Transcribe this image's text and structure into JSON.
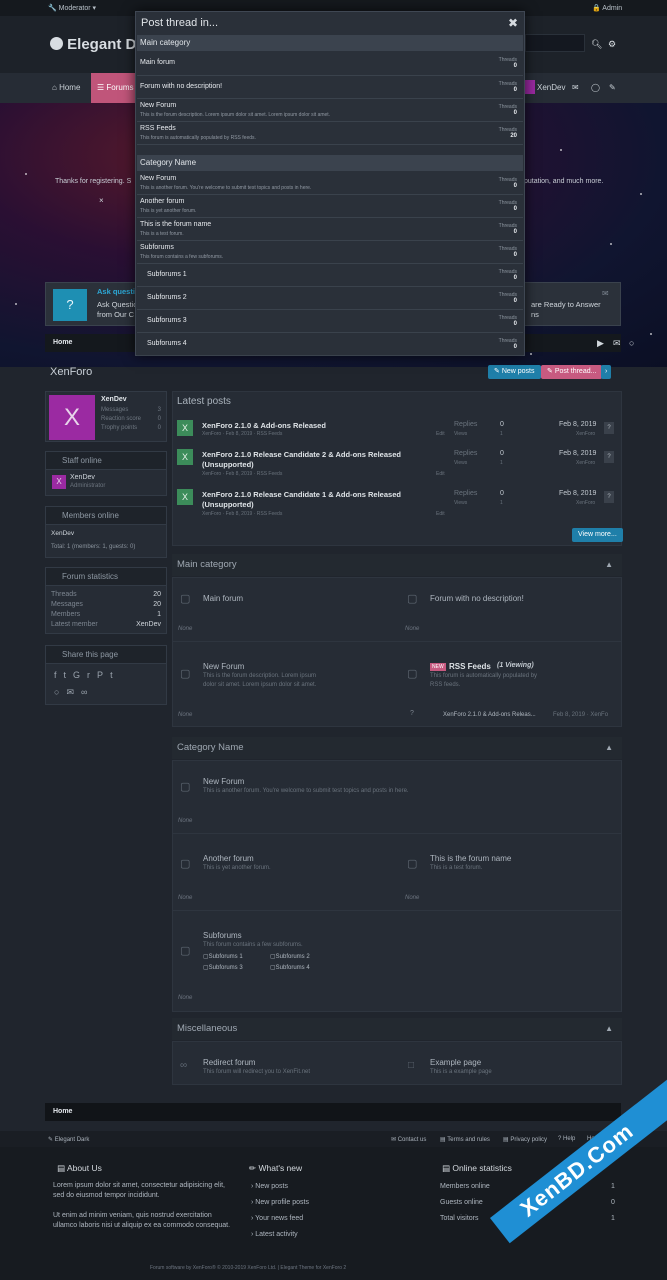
{
  "topbar": {
    "moderator": "Moderator",
    "admin": "Admin"
  },
  "header": {
    "logo": "Elegant D"
  },
  "nav": {
    "home": "Home",
    "forums": "Forums",
    "user": "XenDev"
  },
  "hero": {
    "left_text": "Thanks for registering. S",
    "right_text": "putation, and much more."
  },
  "notice": {
    "title": "Ask questi",
    "line1": "Ask Questio",
    "line2": "from Our C",
    "right1": "are Ready to Answer",
    "right2": "ns"
  },
  "breadcrumb": {
    "home": "Home"
  },
  "page": {
    "title": "XenForo",
    "new_posts": "New posts",
    "post_thread": "Post thread..."
  },
  "user_card": {
    "avatar_letter": "X",
    "name": "XenDev",
    "stats": [
      {
        "label": "Messages",
        "value": "3"
      },
      {
        "label": "Reaction score",
        "value": "0"
      },
      {
        "label": "Trophy points",
        "value": "0"
      }
    ]
  },
  "staff_online": {
    "title": "Staff online",
    "name": "XenDev",
    "role": "Administrator",
    "avatar": "X"
  },
  "members_online": {
    "title": "Members online",
    "name": "XenDev",
    "total": "Total: 1 (members: 1, guests: 0)"
  },
  "forum_stats": {
    "title": "Forum statistics",
    "rows": [
      {
        "label": "Threads",
        "value": "20"
      },
      {
        "label": "Messages",
        "value": "20"
      },
      {
        "label": "Members",
        "value": "1"
      },
      {
        "label": "Latest member",
        "value": "XenDev"
      }
    ]
  },
  "share": {
    "title": "Share this page"
  },
  "latest_posts": {
    "title": "Latest posts",
    "view_more": "View more...",
    "items": [
      {
        "title": "XenForo 2.1.0 & Add-ons Released",
        "title2": "",
        "meta": "XenForo · Feb 8, 2019 · RSS Feeds",
        "replies": "0",
        "views": "1",
        "date": "Feb 8, 2019",
        "by": "XenForo"
      },
      {
        "title": "XenForo 2.1.0 Release Candidate 2 & Add-ons Released",
        "title2": "(Unsupported)",
        "meta": "XenForo · Feb 8, 2019 · RSS Feeds",
        "replies": "0",
        "views": "1",
        "date": "Feb 8, 2019",
        "by": "XenForo"
      },
      {
        "title": "XenForo 2.1.0 Release Candidate 1 & Add-ons Released",
        "title2": "(Unsupported)",
        "meta": "XenForo · Feb 8, 2019 · RSS Feeds",
        "replies": "0",
        "views": "1",
        "date": "Feb 8, 2019",
        "by": "XenForo"
      }
    ],
    "replies_label": "Replies",
    "views_label": "Views",
    "edit": "Edit"
  },
  "main_category": {
    "title": "Main category",
    "main_forum": "Main forum",
    "no_desc": "Forum with no description!",
    "new_forum": "New Forum",
    "new_forum_desc1": "This is the forum description. Lorem ipsum",
    "new_forum_desc2": "dolor sit amet. Lorem ipsum dolor sit amet.",
    "new_badge": "NEW",
    "rss": "RSS Feeds",
    "viewing": "(1 Viewing)",
    "rss_desc1": "This forum is automatically populated by",
    "rss_desc2": "RSS feeds.",
    "none": "None",
    "rss_last": "XenForo 2.1.0 & Add-ons Releas...",
    "rss_last_meta": "Feb 8, 2019 · XenFo"
  },
  "category_name": {
    "title": "Category Name",
    "new_forum": "New Forum",
    "new_forum_desc": "This is another forum. You're welcome to submit test topics and posts in here.",
    "another": "Another forum",
    "another_desc": "This is yet another forum.",
    "forum_name": "This is the forum name",
    "forum_name_desc": "This is a test forum.",
    "subforums": "Subforums",
    "subforums_desc": "This forum contains a few subforums.",
    "subs": [
      "Subforums 1",
      "Subforums 2",
      "Subforums 3",
      "Subforums 4"
    ],
    "none": "None"
  },
  "misc": {
    "title": "Miscellaneous",
    "redirect": "Redirect forum",
    "redirect_desc": "This forum will redirect you to XenFit.net",
    "example": "Example page",
    "example_desc": "This is a example page"
  },
  "modal": {
    "title": "Post thread in...",
    "threads_label": "Threads",
    "cat1": "Main category",
    "cat2": "Category Name",
    "items1": [
      {
        "name": "Main forum",
        "desc": "",
        "threads": "0"
      },
      {
        "name": "Forum with no description!",
        "desc": "",
        "threads": "0"
      },
      {
        "name": "New Forum",
        "desc": "This is the forum description. Lorem ipsum dolor sit amet. Lorem ipsum dolor sit amet.",
        "threads": "0"
      },
      {
        "name": "RSS Feeds",
        "desc": "This forum is automatically populated by RSS feeds.",
        "threads": "20"
      }
    ],
    "items2": [
      {
        "name": "New Forum",
        "desc": "This is another forum. You're welcome to submit test topics and posts in here.",
        "threads": "0"
      },
      {
        "name": "Another forum",
        "desc": "This is yet another forum.",
        "threads": "0"
      },
      {
        "name": "This is the forum name",
        "desc": "This is a test forum.",
        "threads": "0"
      },
      {
        "name": "Subforums",
        "desc": "This forum contains a few subforums.",
        "threads": "0"
      },
      {
        "name": "Subforums 1",
        "desc": "",
        "threads": "0"
      },
      {
        "name": "Subforums 2",
        "desc": "",
        "threads": "0"
      },
      {
        "name": "Subforums 3",
        "desc": "",
        "threads": "0"
      },
      {
        "name": "Subforums 4",
        "desc": "",
        "threads": "0"
      }
    ]
  },
  "footer": {
    "style": "Elegant Dark",
    "contact": "Contact us",
    "terms": "Terms and rules",
    "privacy": "Privacy policy",
    "help": "Help",
    "home": "Home",
    "about_title": "About Us",
    "about1": "Lorem ipsum dolor sit amet, consectetur adipisicing elit, sed do eiusmod tempor incididunt.",
    "about2": "Ut enim ad minim veniam, quis nostrud exercitation ullamco laboris nisi ut aliquip ex ea commodo consequat.",
    "whats_new": "What's new",
    "links": [
      "New posts",
      "New profile posts",
      "Your news feed",
      "Latest activity"
    ],
    "online_title": "Online statistics",
    "online": [
      {
        "label": "Members online",
        "value": "1"
      },
      {
        "label": "Guests online",
        "value": "0"
      },
      {
        "label": "Total visitors",
        "value": "1"
      }
    ],
    "copyright": "Forum software by XenForo® © 2010-2019 XenForo Ltd. | Elegant Theme for XenForo 2",
    "watermark": "XenBD.Com"
  }
}
